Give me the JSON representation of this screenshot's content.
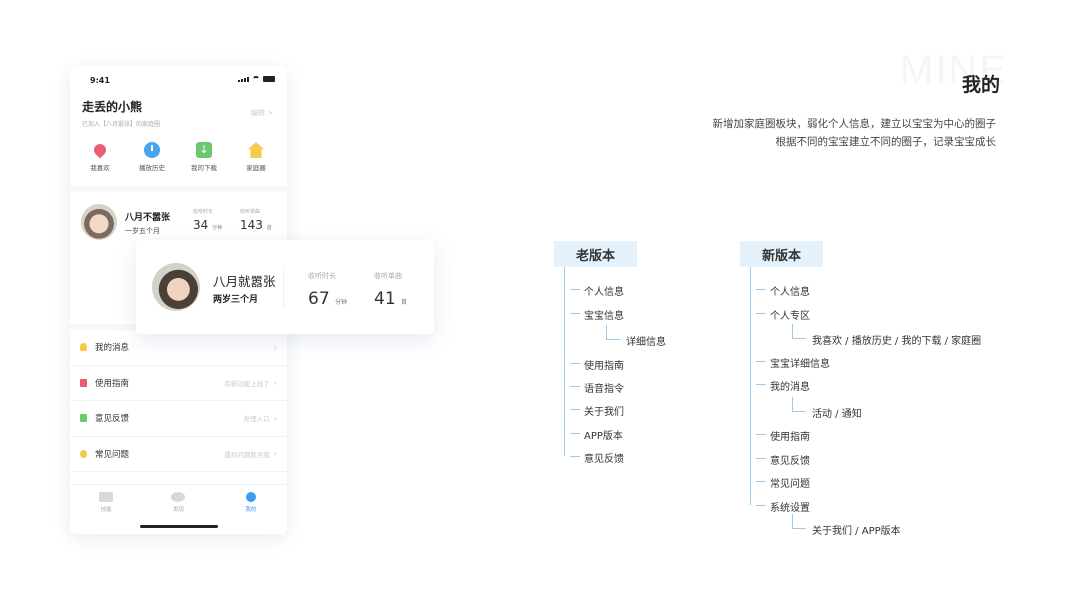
{
  "phone": {
    "status_time": "9:41",
    "user_title": "走丢的小熊",
    "user_sub": "已加入【八月嚣张】的家庭圈",
    "edit": "编辑 >",
    "quick": [
      {
        "label": "我喜欢",
        "icon": "heart-icon"
      },
      {
        "label": "播放历史",
        "icon": "clock-icon"
      },
      {
        "label": "我的下载",
        "icon": "download-icon"
      },
      {
        "label": "家庭圈",
        "icon": "home-icon"
      }
    ],
    "baby": {
      "name": "八月不嚣张",
      "age": "一岁五个月",
      "stat1_label": "收听时长",
      "stat1_value": "34",
      "stat1_unit": "分钟",
      "stat2_label": "收听单曲",
      "stat2_value": "143",
      "stat2_unit": "首"
    },
    "menu": [
      {
        "label": "我的消息",
        "hint": "",
        "color": "#f6c744"
      },
      {
        "label": "使用指南",
        "hint": "有新功能上线了",
        "color": "#ec5c73"
      },
      {
        "label": "意见反馈",
        "hint": "处理入口",
        "color": "#6cc86f"
      },
      {
        "label": "常见问题",
        "hint": "遇到问题就点我",
        "color": "#f6c744"
      }
    ],
    "tabs": [
      "技能",
      "发现",
      "我的"
    ]
  },
  "card": {
    "name": "八月就嚣张",
    "age": "两岁三个月",
    "stat1_label": "收听时长",
    "stat1_value": "67",
    "stat1_unit": "分钟",
    "stat2_label": "收听单曲",
    "stat2_value": "41",
    "stat2_unit": "首"
  },
  "header": {
    "bg_word": "MINE",
    "title": "我的",
    "desc1": "新增加家庭圈板块，弱化个人信息，建立以宝宝为中心的圈子",
    "desc2": "根据不同的宝宝建立不同的圈子，记录宝宝成长"
  },
  "old_tree": {
    "title": "老版本",
    "items": [
      "个人信息",
      "宝宝信息",
      "详细信息",
      "使用指南",
      "语音指令",
      "关于我们",
      "APP版本",
      "意见反馈"
    ]
  },
  "new_tree": {
    "title": "新版本",
    "items": [
      "个人信息",
      "个人专区",
      "我喜欢 / 播放历史 / 我的下载 / 家庭圈",
      "宝宝详细信息",
      "我的消息",
      "活动 / 通知",
      "使用指南",
      "意见反馈",
      "常见问题",
      "系统设置",
      "关于我们 / APP版本"
    ]
  }
}
